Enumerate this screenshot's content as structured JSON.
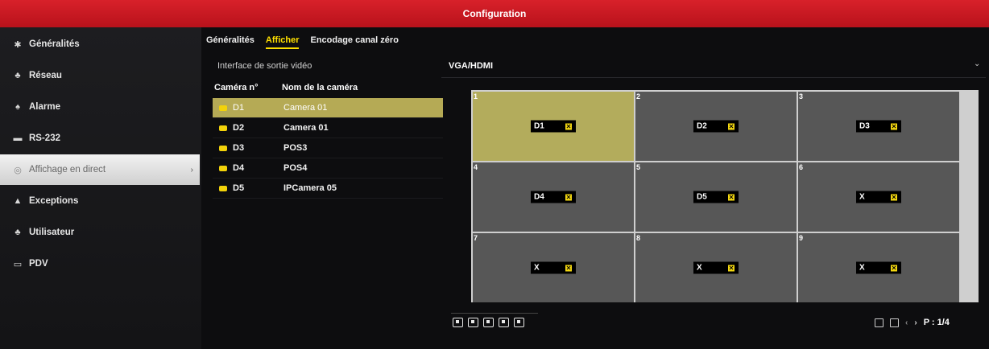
{
  "window": {
    "title": "Configuration"
  },
  "sidebar": {
    "items": [
      {
        "label": "Généralités",
        "icon": "gear-icon",
        "glyph": "✱",
        "active": false
      },
      {
        "label": "Réseau",
        "icon": "network-icon",
        "glyph": "♣",
        "active": false
      },
      {
        "label": "Alarme",
        "icon": "alarm-icon",
        "glyph": "♠",
        "active": false
      },
      {
        "label": "RS-232",
        "icon": "serial-port-icon",
        "glyph": "▬",
        "active": false
      },
      {
        "label": "Affichage en direct",
        "icon": "eye-icon",
        "glyph": "◎",
        "active": true
      },
      {
        "label": "Exceptions",
        "icon": "warning-icon",
        "glyph": "▲",
        "active": false
      },
      {
        "label": "Utilisateur",
        "icon": "users-icon",
        "glyph": "♣",
        "active": false
      },
      {
        "label": "PDV",
        "icon": "pos-icon",
        "glyph": "▭",
        "active": false
      }
    ]
  },
  "tabs": [
    {
      "label": "Généralités",
      "active": false
    },
    {
      "label": "Afficher",
      "active": true
    },
    {
      "label": "Encodage canal zéro",
      "active": false
    }
  ],
  "output": {
    "label": "Interface de sortie vidéo",
    "value": "VGA/HDMI"
  },
  "cameras": {
    "headers": {
      "number": "Caméra n°",
      "name": "Nom de la caméra"
    },
    "rows": [
      {
        "id": "D1",
        "name": "Camera 01",
        "selected": true
      },
      {
        "id": "D2",
        "name": "Camera 01",
        "selected": false
      },
      {
        "id": "D3",
        "name": "POS3",
        "selected": false
      },
      {
        "id": "D4",
        "name": "POS4",
        "selected": false
      },
      {
        "id": "D5",
        "name": "IPCamera 05",
        "selected": false
      }
    ]
  },
  "layout_grid": {
    "cells": [
      {
        "num": "1",
        "cam": "D1",
        "selected": true
      },
      {
        "num": "2",
        "cam": "D2",
        "selected": false
      },
      {
        "num": "3",
        "cam": "D3",
        "selected": false
      },
      {
        "num": "4",
        "cam": "D4",
        "selected": false
      },
      {
        "num": "5",
        "cam": "D5",
        "selected": false
      },
      {
        "num": "6",
        "cam": "X",
        "selected": false
      },
      {
        "num": "7",
        "cam": "X",
        "selected": false
      },
      {
        "num": "8",
        "cam": "X",
        "selected": false
      },
      {
        "num": "9",
        "cam": "X",
        "selected": false
      }
    ]
  },
  "layout_buttons": [
    "layout-1-icon",
    "layout-4-icon",
    "layout-6-icon",
    "layout-8-icon",
    "layout-9-icon"
  ],
  "pager": {
    "text": "P : 1/4"
  },
  "colors": {
    "title_bar": "#d8212a",
    "tab_active": "#ffe000",
    "selection": "#b3ac5c"
  }
}
